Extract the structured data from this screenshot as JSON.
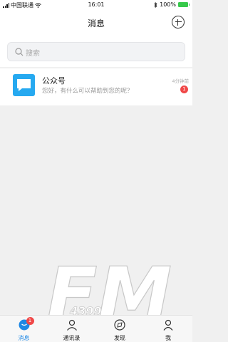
{
  "status_bar": {
    "carrier": "中国联通",
    "time": "16:01",
    "battery": "100%",
    "icons": [
      "signal-icon",
      "wifi-icon",
      "bluetooth-icon",
      "battery-icon"
    ]
  },
  "header": {
    "title": "消息",
    "add_icon": "plus-circle-icon"
  },
  "search": {
    "placeholder": "搜索"
  },
  "conversations": [
    {
      "name": "公众号",
      "preview": "您好，有什么可以帮助到您的呢？",
      "time": "4分钟前",
      "unread": "1",
      "avatar_color": "#26a9f0",
      "avatar_icon": "message-icon"
    }
  ],
  "watermark": {
    "text_large": "FM",
    "text_small": "4399"
  },
  "tabbar": {
    "tabs": [
      {
        "label": "消息",
        "icon": "chat-bubble-icon",
        "badge": "1",
        "active": true
      },
      {
        "label": "通讯录",
        "icon": "contacts-icon",
        "active": false
      },
      {
        "label": "发现",
        "icon": "compass-icon",
        "active": false
      },
      {
        "label": "我",
        "icon": "person-icon",
        "active": false
      }
    ]
  },
  "colors": {
    "accent": "#1e88e5",
    "badge": "#f04848",
    "avatar": "#26a9f0",
    "battery": "#36c94a"
  }
}
